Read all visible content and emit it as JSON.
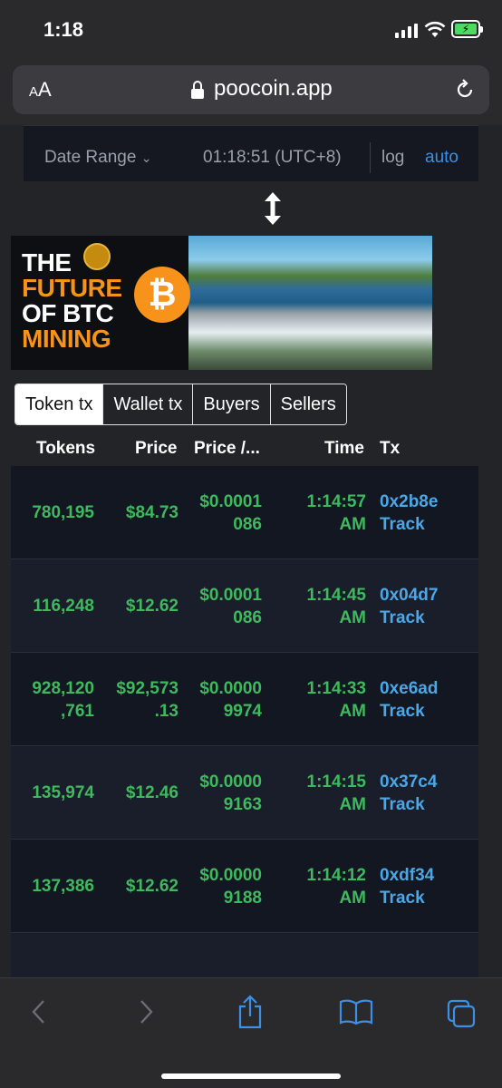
{
  "status": {
    "time": "1:18"
  },
  "browser": {
    "aa_small": "A",
    "aa_big": "A",
    "url": "poocoin.app"
  },
  "chart_controls": {
    "date_range": "Date Range",
    "clock": "01:18:51 (UTC+8)",
    "log": "log",
    "auto": "auto"
  },
  "ad": {
    "line1": "THE",
    "line2": "FUTURE",
    "line3": "OF BTC",
    "line4": "MINING",
    "coin_symbol": "₿"
  },
  "tabs": [
    "Token tx",
    "Wallet tx",
    "Buyers",
    "Sellers"
  ],
  "columns": {
    "tokens": "Tokens",
    "price": "Price",
    "price_per": "Price /...",
    "time": "Time",
    "tx": "Tx"
  },
  "rows": [
    {
      "tokens": [
        "780,195"
      ],
      "price": [
        "$84.73"
      ],
      "price_per": [
        "$0.0001",
        "086"
      ],
      "time": [
        "1:14:57",
        "AM"
      ],
      "tx": [
        "0x2b8e",
        "Track"
      ]
    },
    {
      "tokens": [
        "116,248"
      ],
      "price": [
        "$12.62"
      ],
      "price_per": [
        "$0.0001",
        "086"
      ],
      "time": [
        "1:14:45",
        "AM"
      ],
      "tx": [
        "0x04d7",
        "Track"
      ]
    },
    {
      "tokens": [
        "928,120",
        ",761"
      ],
      "price": [
        "$92,573",
        ".13"
      ],
      "price_per": [
        "$0.0000",
        "9974"
      ],
      "time": [
        "1:14:33",
        "AM"
      ],
      "tx": [
        "0xe6ad",
        "Track"
      ]
    },
    {
      "tokens": [
        "135,974"
      ],
      "price": [
        "$12.46"
      ],
      "price_per": [
        "$0.0000",
        "9163"
      ],
      "time": [
        "1:14:15",
        "AM"
      ],
      "tx": [
        "0x37c4",
        "Track"
      ]
    },
    {
      "tokens": [
        "137,386"
      ],
      "price": [
        "$12.62"
      ],
      "price_per": [
        "$0.0000",
        "9188"
      ],
      "time": [
        "1:14:12",
        "AM"
      ],
      "tx": [
        "0xdf34",
        "Track"
      ]
    }
  ],
  "colors": {
    "buy": "#3fb95d",
    "sell": "#d9434b",
    "link": "#4aa8e8",
    "accent": "#3d8fe6"
  },
  "icons": {
    "lock": "lock-icon",
    "reload": "reload-icon",
    "back": "back-icon",
    "forward": "forward-icon",
    "share": "share-icon",
    "bookmarks": "bookmarks-icon",
    "tabs": "tabs-icon"
  }
}
